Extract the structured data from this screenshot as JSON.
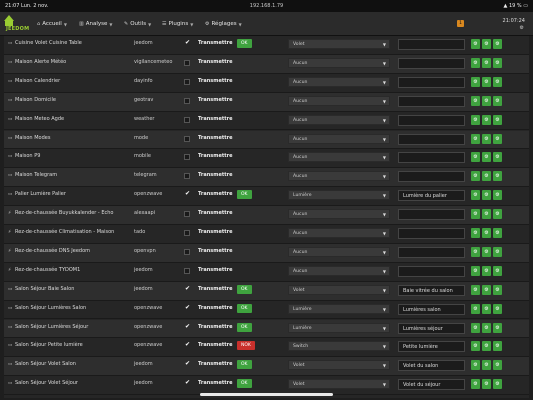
{
  "status_bar": {
    "time": "21:07",
    "date": "Lun. 2 nov.",
    "url": "192.168.1.79",
    "battery": "19 %"
  },
  "navbar": {
    "logo": "JEEDOM",
    "menus": [
      {
        "label": "Accueil",
        "icon": "home-icon"
      },
      {
        "label": "Analyse",
        "icon": "chart-icon"
      },
      {
        "label": "Outils",
        "icon": "wrench-icon"
      },
      {
        "label": "Plugins",
        "icon": "tasks-icon"
      },
      {
        "label": "Réglages",
        "icon": "gears-icon"
      }
    ],
    "notification_count": "1",
    "clock": "21:07:24"
  },
  "table": {
    "transmit_label": "Transmettre",
    "rows": [
      {
        "icon": "desktop-icon",
        "name": "Cuisine Volet Cuisine Table",
        "plugin": "jeedom",
        "checked": true,
        "status": "OK",
        "mode": "Volet",
        "value": ""
      },
      {
        "icon": "desktop-icon",
        "name": "Maison Alerte Météo",
        "plugin": "vigilancemeteo",
        "checked": false,
        "status": "",
        "mode": "Aucun",
        "value": ""
      },
      {
        "icon": "desktop-icon",
        "name": "Maison Calendrier",
        "plugin": "dayinfo",
        "checked": false,
        "status": "",
        "mode": "Aucun",
        "value": ""
      },
      {
        "icon": "desktop-icon",
        "name": "Maison Domicile",
        "plugin": "geotrav",
        "checked": false,
        "status": "",
        "mode": "Aucun",
        "value": ""
      },
      {
        "icon": "desktop-icon",
        "name": "Maison Meteo Agde",
        "plugin": "weather",
        "checked": false,
        "status": "",
        "mode": "Aucun",
        "value": ""
      },
      {
        "icon": "desktop-icon",
        "name": "Maison Modes",
        "plugin": "mode",
        "checked": false,
        "status": "",
        "mode": "Aucun",
        "value": ""
      },
      {
        "icon": "desktop-icon",
        "name": "Maison P9",
        "plugin": "mobile",
        "checked": false,
        "status": "",
        "mode": "Aucun",
        "value": ""
      },
      {
        "icon": "desktop-icon",
        "name": "Maison Telegram",
        "plugin": "telegram",
        "checked": false,
        "status": "",
        "mode": "Aucun",
        "value": ""
      },
      {
        "icon": "desktop-icon",
        "name": "Palier Lumière Palier",
        "plugin": "openzwave",
        "checked": true,
        "status": "OK",
        "mode": "Lumière",
        "value": "Lumière du palier"
      },
      {
        "icon": "plug-icon",
        "name": "Rez-de-chaussée Buyukkalender - Echo",
        "plugin": "alexaapi",
        "checked": false,
        "status": "",
        "mode": "Aucun",
        "value": ""
      },
      {
        "icon": "plug-icon",
        "name": "Rez-de-chaussée Climatisation - Maison",
        "plugin": "tado",
        "checked": false,
        "status": "",
        "mode": "Aucun",
        "value": ""
      },
      {
        "icon": "plug-icon",
        "name": "Rez-de-chaussée DNS Jeedom",
        "plugin": "openvpn",
        "checked": false,
        "status": "",
        "mode": "Aucun",
        "value": ""
      },
      {
        "icon": "plug-icon",
        "name": "Rez-de-chaussée TYDOM1",
        "plugin": "jeedom",
        "checked": false,
        "status": "",
        "mode": "Aucun",
        "value": ""
      },
      {
        "icon": "desktop-icon",
        "name": "Salon Séjour Baie Salon",
        "plugin": "jeedom",
        "checked": true,
        "status": "OK",
        "mode": "Volet",
        "value": "Baie vitrée du salon"
      },
      {
        "icon": "desktop-icon",
        "name": "Salon Séjour Lumières Salon",
        "plugin": "openzwave",
        "checked": true,
        "status": "OK",
        "mode": "Lumière",
        "value": "Lumières salon"
      },
      {
        "icon": "desktop-icon",
        "name": "Salon Séjour Lumières Séjour",
        "plugin": "openzwave",
        "checked": true,
        "status": "OK",
        "mode": "Lumière",
        "value": "Lumières séjour"
      },
      {
        "icon": "desktop-icon",
        "name": "Salon Séjour Petite lumière",
        "plugin": "openzwave",
        "checked": true,
        "status": "NOK",
        "mode": "Switch",
        "value": "Petite lumière"
      },
      {
        "icon": "desktop-icon",
        "name": "Salon Séjour Volet Salon",
        "plugin": "jeedom",
        "checked": true,
        "status": "OK",
        "mode": "Volet",
        "value": "Volet du salon"
      },
      {
        "icon": "desktop-icon",
        "name": "Salon Séjour Volet Séjour",
        "plugin": "jeedom",
        "checked": true,
        "status": "OK",
        "mode": "Volet",
        "value": "Volet du séjour"
      }
    ]
  },
  "colors": {
    "accent": "#3fa33f",
    "danger": "#c9302c",
    "notification": "#d9881f"
  }
}
